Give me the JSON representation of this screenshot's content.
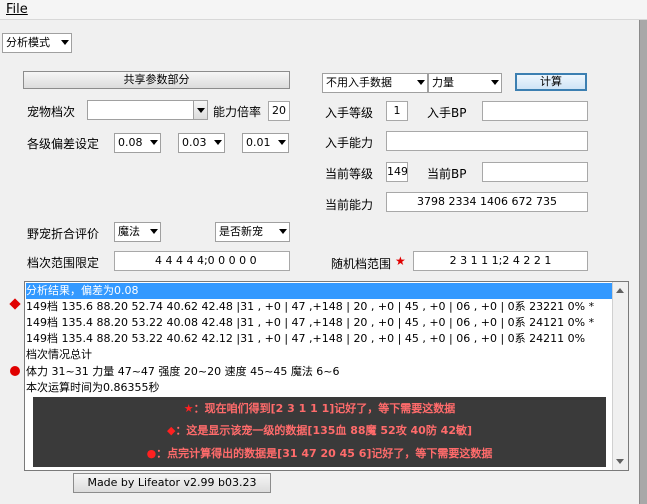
{
  "menu": {
    "file": "File"
  },
  "mode": {
    "value": "分析模式"
  },
  "shared_button": "共享参数部分",
  "pet": {
    "label": "宠物档次",
    "value": "",
    "ratio_label": "能力倍率",
    "ratio_value": "20"
  },
  "deviation": {
    "label": "各级偏差设定",
    "values": [
      "0.08",
      "0.03",
      "0.01"
    ]
  },
  "wild": {
    "label": "野宠折合评价",
    "value": "魔法",
    "new_value": "是否新宠"
  },
  "range": {
    "label": "档次范围限定",
    "value": "4 4 4 4 4;0 0 0 0 0"
  },
  "entry": {
    "mode_value": "不用入手数据",
    "stat_value": "力量",
    "calc_button": "计算",
    "level_label": "入手等级",
    "level_value": "1",
    "bp_label": "入手BP",
    "bp_value": "",
    "ability_label": "入手能力",
    "ability_value": ""
  },
  "current": {
    "level_label": "当前等级",
    "level_value": "149",
    "bp_label": "当前BP",
    "bp_value": "",
    "ability_label": "当前能力",
    "ability_value": "3798 2334 1406 672 735"
  },
  "random": {
    "label": "随机档范围",
    "value": "2 3 1 1 1;2 4 2 2 1"
  },
  "results": [
    "分析结果，偏差为0.08",
    "149档 135.6 88.20 52.74 40.62 42.48 |31 , +0 | 47 ,+148 | 20 , +0 | 45 , +0 | 06 , +0 | 0系  23221   0% *",
    "149档 135.4 88.20 53.22 40.08 42.48 |31 , +0 | 47 ,+148 | 20 , +0 | 45 , +0 | 06 , +0 | 0系  24121   0% *",
    "149档 135.4 88.20 53.22 40.62 42.12 |31 , +0 | 47 ,+148 | 20 , +0 | 45 , +0 | 06 , +0 | 0系  24211   0%",
    "档次情况总计",
    "体力 31~31 力量 47~47 强度 20~20 速度 45~45 魔法 6~6",
    "本次运算时间为0.86355秒"
  ],
  "notes": {
    "star": {
      "mark": "★",
      "text": "：现在咱们得到[2  3  1  1  1]记好了，等下需要这数据"
    },
    "diamond": {
      "mark": "◆",
      "text": "：这是显示该宠一级的数据[135血  88魔  52攻  40防  42敏]"
    },
    "dot": {
      "mark": "●",
      "text": "：点完计算得出的数据是[31  47  20  45  6]记好了，等下需要这数据"
    }
  },
  "footer": "Made by Lifeator  v2.99 b03.23",
  "colors": {
    "accent": "#e00000",
    "selection": "#3399ff",
    "note_bg": "#3a3a3a"
  }
}
